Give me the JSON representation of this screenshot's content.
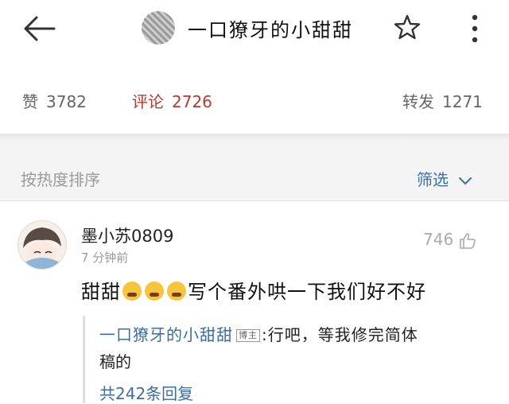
{
  "header": {
    "title": "一口獠牙的小甜甜",
    "back_icon": "arrow-left-icon",
    "star_icon": "star-outline-icon",
    "more_icon": "more-vertical-icon"
  },
  "stats": {
    "likes_label": "赞",
    "likes_count": "3782",
    "comments_label": "评论",
    "comments_count": "2726",
    "reposts_label": "转发",
    "reposts_count": "1271",
    "active_color": "#b53a2e"
  },
  "sortbar": {
    "sort_label": "按热度排序",
    "filter_label": "筛选",
    "accent_color": "#3a6ea5"
  },
  "comment": {
    "username": "墨小苏0809",
    "time": "7 分钟前",
    "like_count": "746",
    "text_before": "甜甜",
    "text_after": "写个番外哄一下我们好不好",
    "emoji_icon": "crying-face-icon",
    "reply": {
      "author": "一口獠牙的小甜甜",
      "badge": "博主",
      "text_line1": ":行吧，等我修完简体",
      "text_line2": "稿的",
      "more_replies": "共242条回复"
    }
  }
}
